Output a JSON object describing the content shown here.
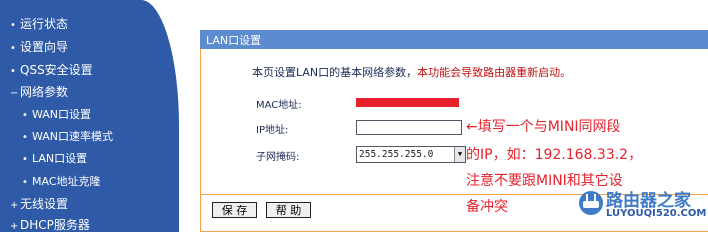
{
  "sidebar": {
    "items": [
      {
        "label": "运行状态",
        "bullet": "•"
      },
      {
        "label": "设置向导",
        "bullet": "•"
      },
      {
        "label": "QSS安全设置",
        "bullet": "•"
      },
      {
        "label": "网络参数",
        "bullet": "−"
      },
      {
        "label": "WAN口设置",
        "bullet": "•"
      },
      {
        "label": "WAN口速率模式",
        "bullet": "•"
      },
      {
        "label": "LAN口设置",
        "bullet": "•"
      },
      {
        "label": "MAC地址克隆",
        "bullet": "•"
      },
      {
        "label": "无线设置",
        "bullet": "+"
      },
      {
        "label": "DHCP服务器",
        "bullet": "+"
      }
    ]
  },
  "panel": {
    "title": "LAN口设置",
    "intro": "本页设置LAN口的基本网络参数，",
    "intro_warning": "本功能会导致路由器重新启动。",
    "mac_label": "MAC地址:",
    "ip_label": "IP地址:",
    "ip_value": "",
    "mask_label": "子网掩码:",
    "mask_value": "255.255.255.0",
    "save_label": "保 存",
    "help_label": "帮 助"
  },
  "annotation": {
    "lines": [
      "←填写一个与MINI同网段",
      "的IP，如：192.168.33.2，",
      "注意不要跟MINI和其它设",
      "备冲突"
    ]
  },
  "watermark": {
    "title": "路由器之家",
    "url": "LUYOUQI520.COM"
  },
  "colors": {
    "sidebar": "#2e5aa8",
    "header": "#5d8bd0",
    "border": "#f5a04a",
    "annotation": "#e8222d"
  }
}
